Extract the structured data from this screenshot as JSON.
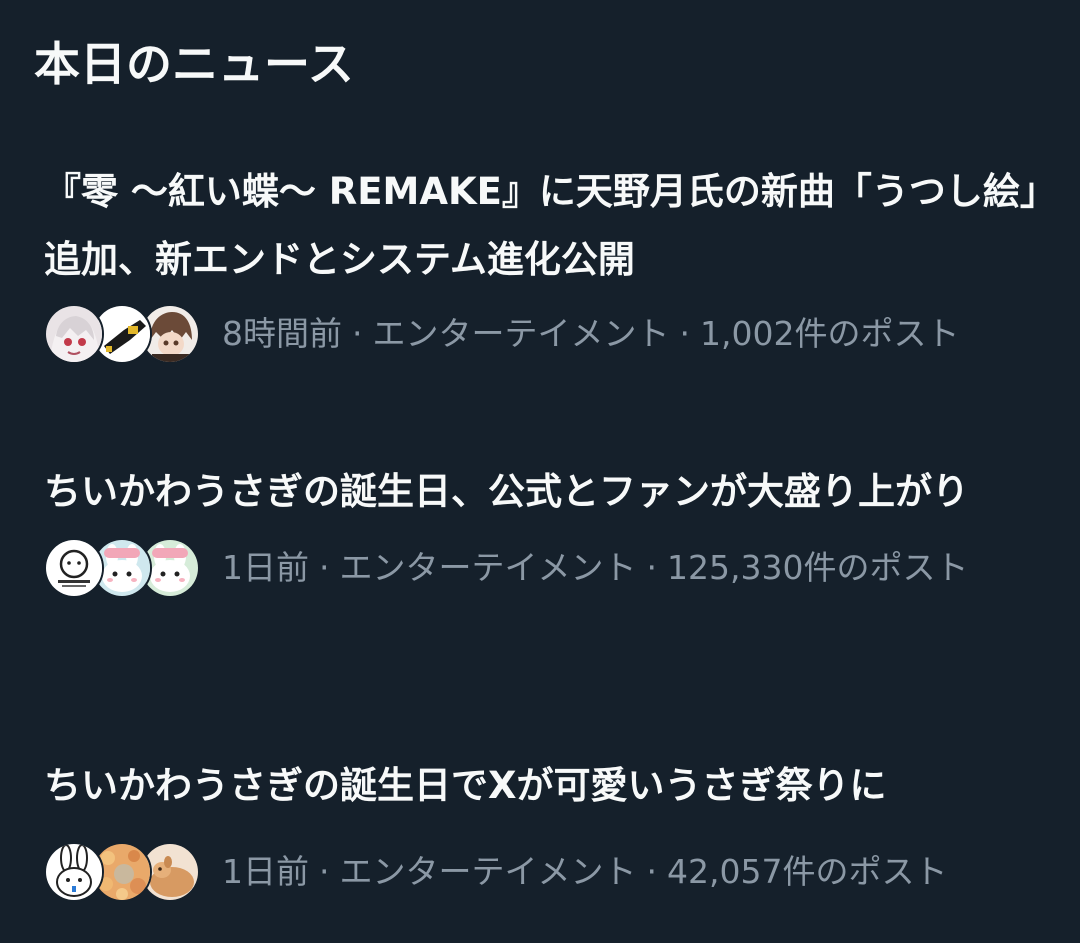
{
  "section": {
    "title": "本日のニュース"
  },
  "news": [
    {
      "headline": "『零 〜紅い蝶〜 REMAKE』に天野月氏の新曲「うつし絵」追加、新エンドとシステム進化公開",
      "time": "8時間前",
      "category": "エンターテイメント",
      "posts": "1,002件のポスト",
      "separator": "·"
    },
    {
      "headline": "ちいかわうさぎの誕生日、公式とファンが大盛り上がり",
      "time": "1日前",
      "category": "エンターテイメント",
      "posts": "125,330件のポスト",
      "separator": "·"
    },
    {
      "headline": "ちいかわうさぎの誕生日でXが可愛いうさぎ祭りに",
      "time": "1日前",
      "category": "エンターテイメント",
      "posts": "42,057件のポスト",
      "separator": "·"
    }
  ],
  "colors": {
    "background": "#15202b",
    "headline": "#f7f9f9",
    "meta": "#8b98a5"
  }
}
